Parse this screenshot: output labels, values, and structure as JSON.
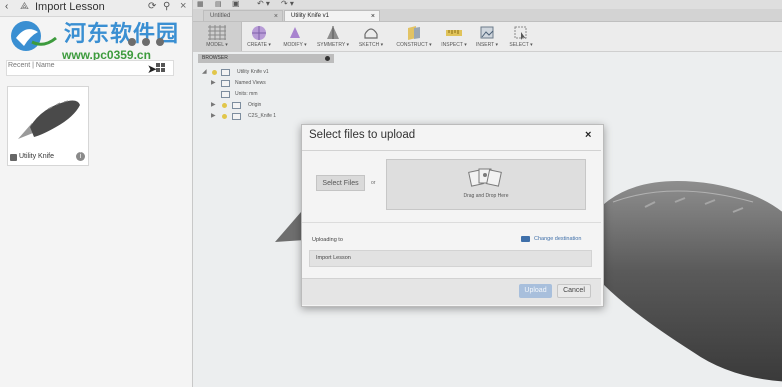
{
  "panel": {
    "back_glyph": "‹",
    "title": "Import Lesson",
    "refresh_glyph": "⟳",
    "search_glyph": "⚲",
    "close_glyph": "×",
    "sort_label": "Recent | Name",
    "items": [
      {
        "name": "Utility Knife",
        "info_glyph": "i"
      }
    ]
  },
  "watermark": {
    "title": "河东软件园",
    "url": "www.pc0359.cn"
  },
  "app_bar": {
    "grid_glyph": "▦",
    "file_glyph": "▤",
    "save_glyph": "▣",
    "undo_glyph": "↶ ▾",
    "redo_glyph": "↷ ▾"
  },
  "tabs": [
    {
      "label": "Untitled",
      "close": "×"
    },
    {
      "label": "Utility Knife v1",
      "close": "×"
    }
  ],
  "ribbon": {
    "workspace_label": "MODEL ▾",
    "buttons": [
      {
        "label": "CREATE ▾"
      },
      {
        "label": "MODIFY ▾"
      },
      {
        "label": "SYMMETRY ▾"
      },
      {
        "label": "SKETCH ▾"
      },
      {
        "label": "CONSTRUCT ▾"
      },
      {
        "label": "INSPECT ▾"
      },
      {
        "label": "INSERT ▾"
      },
      {
        "label": "SELECT ▾"
      }
    ]
  },
  "browser": {
    "title": "BROWSER",
    "root": "Utility Knife v1",
    "nodes": [
      "Named Views",
      "Units: mm",
      "Origin",
      "C2S_Knife 1"
    ]
  },
  "dialog": {
    "title": "Select files to upload",
    "close_glyph": "×",
    "select_files_label": "Select Files",
    "or_label": "or",
    "drop_text": "Drag and Drop Here",
    "uploading_to_label": "Uploading to",
    "change_destination_label": "Change destination",
    "destination_value": "Import Lesson",
    "upload_label": "Upload",
    "cancel_label": "Cancel"
  },
  "colors": {
    "accent": "#3f6fa9",
    "upload_button": "#a8bfdc",
    "watermark_blue": "#3a8fd2",
    "watermark_green": "#3d9b3d"
  }
}
